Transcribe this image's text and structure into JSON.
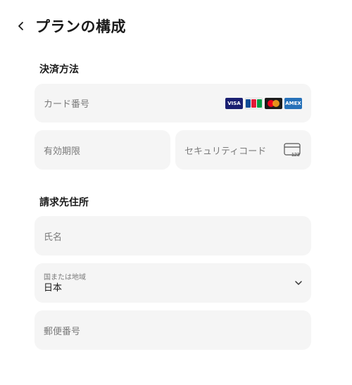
{
  "header": {
    "title": "プランの構成"
  },
  "payment": {
    "section_title": "決済方法",
    "card_number_placeholder": "カード番号",
    "expiry_placeholder": "有効期限",
    "security_code_placeholder": "セキュリティコード",
    "cvc_sample": "123",
    "brands": {
      "visa": "VISA",
      "jcb": "JCB",
      "amex": "AMEX"
    }
  },
  "billing": {
    "section_title": "請求先住所",
    "name_placeholder": "氏名",
    "country_label": "国または地域",
    "country_value": "日本",
    "postal_placeholder": "郵便番号"
  }
}
